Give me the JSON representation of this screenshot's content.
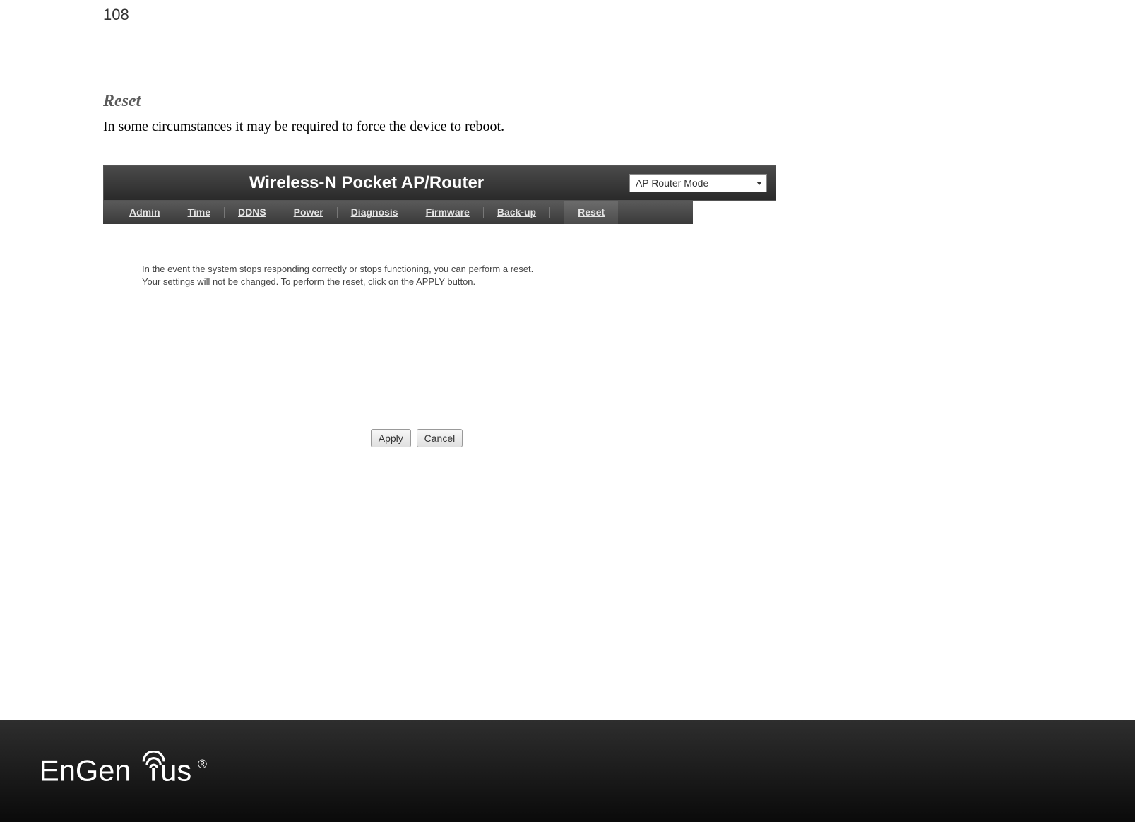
{
  "page": {
    "number": "108",
    "section_title": "Reset",
    "section_desc": "In some circumstances it may be required to force the device to reboot."
  },
  "router": {
    "header_title": "Wireless-N Pocket AP/Router",
    "mode_selected": "AP Router Mode",
    "tabs": [
      {
        "label": "Admin"
      },
      {
        "label": "Time"
      },
      {
        "label": "DDNS"
      },
      {
        "label": "Power"
      },
      {
        "label": "Diagnosis"
      },
      {
        "label": "Firmware"
      },
      {
        "label": "Back-up"
      },
      {
        "label": "Reset"
      }
    ],
    "content_line1": "In the event the system stops responding correctly or stops functioning, you can perform a reset.",
    "content_line2": "Your settings will not be changed. To perform the reset, click on the APPLY button.",
    "buttons": {
      "apply": "Apply",
      "cancel": "Cancel"
    }
  },
  "footer": {
    "brand": "EnGenius",
    "registered": "®"
  }
}
